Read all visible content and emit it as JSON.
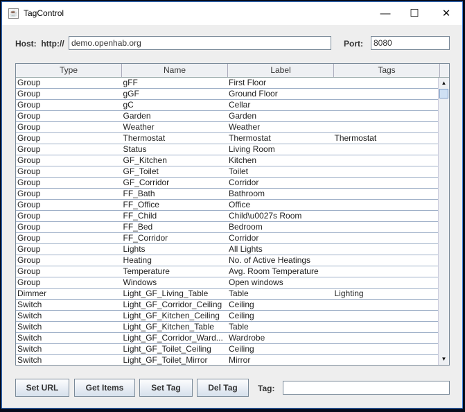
{
  "window": {
    "title": "TagControl",
    "minimize": "—",
    "maximize": "☐",
    "close": "✕"
  },
  "host": {
    "label": "Host:  http://",
    "value": "demo.openhab.org"
  },
  "port": {
    "label": "Port:",
    "value": "8080"
  },
  "table": {
    "columns": [
      "Type",
      "Name",
      "Label",
      "Tags"
    ],
    "rows": [
      [
        "Group",
        "gFF",
        "First Floor",
        ""
      ],
      [
        "Group",
        "gGF",
        "Ground Floor",
        ""
      ],
      [
        "Group",
        "gC",
        "Cellar",
        ""
      ],
      [
        "Group",
        "Garden",
        "Garden",
        ""
      ],
      [
        "Group",
        "Weather",
        "Weather",
        ""
      ],
      [
        "Group",
        "Thermostat",
        "Thermostat",
        "Thermostat"
      ],
      [
        "Group",
        "Status",
        "Living Room",
        ""
      ],
      [
        "Group",
        "GF_Kitchen",
        "Kitchen",
        ""
      ],
      [
        "Group",
        "GF_Toilet",
        "Toilet",
        ""
      ],
      [
        "Group",
        "GF_Corridor",
        "Corridor",
        ""
      ],
      [
        "Group",
        "FF_Bath",
        "Bathroom",
        ""
      ],
      [
        "Group",
        "FF_Office",
        "Office",
        ""
      ],
      [
        "Group",
        "FF_Child",
        "Child\\u0027s Room",
        ""
      ],
      [
        "Group",
        "FF_Bed",
        "Bedroom",
        ""
      ],
      [
        "Group",
        "FF_Corridor",
        "Corridor",
        ""
      ],
      [
        "Group",
        "Lights",
        "All Lights",
        ""
      ],
      [
        "Group",
        "Heating",
        "No. of Active Heatings",
        ""
      ],
      [
        "Group",
        "Temperature",
        "Avg. Room Temperature",
        ""
      ],
      [
        "Group",
        "Windows",
        "Open windows",
        ""
      ],
      [
        "Dimmer",
        "Light_GF_Living_Table",
        "Table",
        "Lighting"
      ],
      [
        "Switch",
        "Light_GF_Corridor_Ceiling",
        "Ceiling",
        ""
      ],
      [
        "Switch",
        "Light_GF_Kitchen_Ceiling",
        "Ceiling",
        ""
      ],
      [
        "Switch",
        "Light_GF_Kitchen_Table",
        "Table",
        ""
      ],
      [
        "Switch",
        "Light_GF_Corridor_Ward...",
        "Wardrobe",
        ""
      ],
      [
        "Switch",
        "Light_GF_Toilet_Ceiling",
        "Ceiling",
        ""
      ],
      [
        "Switch",
        "Light_GF_Toilet_Mirror",
        "Mirror",
        ""
      ]
    ]
  },
  "buttons": {
    "set_url": "Set URL",
    "get_items": "Get Items",
    "set_tag": "Set Tag",
    "del_tag": "Del Tag"
  },
  "tag": {
    "label": "Tag:",
    "value": ""
  }
}
